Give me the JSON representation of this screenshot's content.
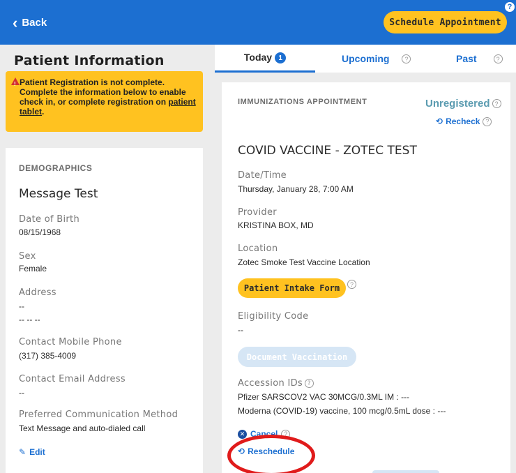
{
  "header": {
    "back_label": "Back",
    "schedule_button": "Schedule Appointment",
    "help": "?"
  },
  "left": {
    "title": "Patient Information",
    "warning": {
      "text": "Patient Registration is not complete. Complete the information below to enable check in, or complete registration on",
      "link": "patient tablet",
      "suffix": "."
    },
    "demographics": {
      "heading": "DEMOGRAPHICS",
      "name": "Message Test",
      "fields": {
        "dob_label": "Date of Birth",
        "dob_value": "08/15/1968",
        "sex_label": "Sex",
        "sex_value": "Female",
        "address_label": "Address",
        "address_line1": "--",
        "address_line2": "-- -- --",
        "phone_label": "Contact Mobile Phone",
        "phone_value": "(317) 385-4009",
        "email_label": "Contact Email Address",
        "email_value": "--",
        "pref_label": "Preferred Communication Method",
        "pref_value": "Text Message and auto-dialed call"
      },
      "edit_label": "Edit"
    }
  },
  "tabs": {
    "today": "Today",
    "today_count": "1",
    "upcoming": "Upcoming",
    "past": "Past"
  },
  "appointment": {
    "heading": "IMMUNIZATIONS APPOINTMENT",
    "status": "Unregistered",
    "recheck": "Recheck",
    "title": "COVID VACCINE - ZOTEC TEST",
    "datetime_label": "Date/Time",
    "datetime_value": "Thursday, January 28, 7:00 AM",
    "provider_label": "Provider",
    "provider_value": "KRISTINA BOX, MD",
    "location_label": "Location",
    "location_value": "Zotec Smoke Test Vaccine Location",
    "intake_button": "Patient Intake Form",
    "eligibility_label": "Eligibility Code",
    "eligibility_value": "--",
    "document_button": "Document Vaccination",
    "accession_label": "Accession IDs",
    "accession_1": "Pfizer SARSCOV2 VAC 30MCG/0.3ML IM : ---",
    "accession_2": "Moderna (COVID-19) vaccine, 100 mcg/0.5mL dose : ---",
    "cancel": "Cancel",
    "reschedule": "Reschedule"
  },
  "colors": {
    "primary": "#1c6fd1",
    "accent": "#ffc220",
    "status": "#5a9bb0",
    "highlight_ring": "#e01b1b"
  }
}
